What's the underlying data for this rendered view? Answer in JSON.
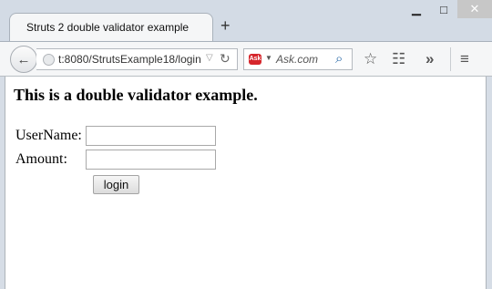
{
  "browser": {
    "tab_title": "Struts 2 double validator example",
    "new_tab_label": "+",
    "url": "t:8080/StrutsExample18/login",
    "search_placeholder": "Ask.com",
    "search_engine_logo": "Ask",
    "icons": {
      "minimize": "minimize-icon",
      "maximize": "maximize-icon",
      "close": "close-icon",
      "back": "back-arrow-icon",
      "globe": "globe-icon",
      "reload": "reload-icon",
      "search": "search-icon",
      "bookmark": "star-icon",
      "reading_list": "clipboard-icon",
      "overflow": "chevron-double-right-icon",
      "menu": "hamburger-menu-icon"
    }
  },
  "page": {
    "heading": "This is a double validator example.",
    "form": {
      "username_label": "UserName:",
      "username_value": "",
      "amount_label": "Amount:",
      "amount_value": "",
      "submit_label": "login"
    }
  }
}
